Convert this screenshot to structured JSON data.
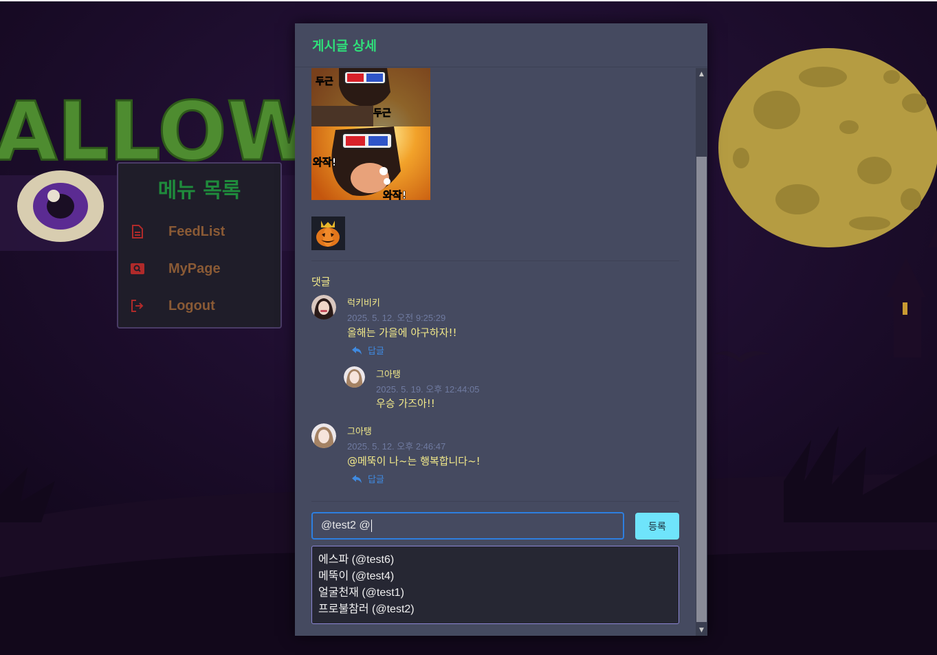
{
  "menu": {
    "title": "메뉴 목록",
    "items": [
      {
        "label": "FeedList",
        "icon": "document-icon"
      },
      {
        "label": "MyPage",
        "icon": "search-card-icon"
      },
      {
        "label": "Logout",
        "icon": "logout-icon"
      }
    ]
  },
  "background": {
    "banner_text": "ALLOW",
    "colors": {
      "sky": "#1c0d2c",
      "moon": "#b59c42",
      "slime": "#4e8c30"
    }
  },
  "modal": {
    "title": "게시글 상세",
    "post_image": {
      "captions": [
        "두근",
        "두근",
        "와작!",
        "와작!"
      ]
    },
    "comments_title": "댓글",
    "comments": [
      {
        "author": "럭키비키",
        "time": "2025. 5. 12. 오전 9:25:29",
        "text": "올해는 가을에 야구하자!!",
        "reply_label": "답글",
        "replies": [
          {
            "author": "그아탱",
            "time": "2025. 5. 19. 오후 12:44:05",
            "text": "우승 가즈아!!"
          }
        ]
      },
      {
        "author": "그아탱",
        "time": "2025. 5. 12. 오후 2:46:47",
        "text": "@메뚝이 나~는 행복합니다~!",
        "reply_label": "답글"
      }
    ],
    "input": {
      "value": "@test2 @"
    },
    "submit_label": "등록",
    "suggestions": [
      "에스파 (@test6)",
      "메뚝이 (@test4)",
      "얼굴천재 (@test1)",
      "프로불참러 (@test2)"
    ],
    "colors": {
      "accent_title": "#2fe07a",
      "comment_text": "#f2e98a",
      "link": "#3f8ae0",
      "button": "#6fe4fb"
    }
  }
}
